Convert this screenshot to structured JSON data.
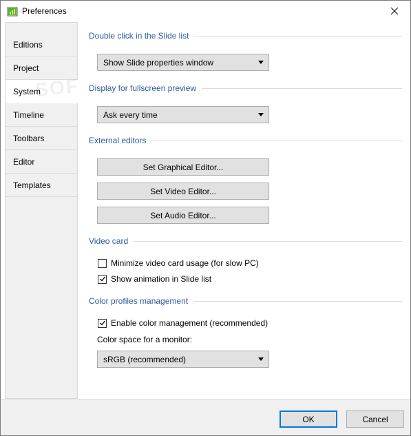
{
  "window": {
    "title": "Preferences"
  },
  "icons": {
    "app": "app-icon",
    "close": "close-icon",
    "checkmark": "checkmark-icon",
    "dropdown_arrow": "chevron-down-icon"
  },
  "sidebar": {
    "items": [
      {
        "label": "Editions"
      },
      {
        "label": "Project"
      },
      {
        "label": "System"
      },
      {
        "label": "Timeline"
      },
      {
        "label": "Toolbars"
      },
      {
        "label": "Editor"
      },
      {
        "label": "Templates"
      }
    ],
    "active": "System"
  },
  "main": {
    "double_click": {
      "header": "Double click in the Slide list",
      "selected": "Show Slide properties window"
    },
    "fullscreen_preview": {
      "header": "Display for fullscreen preview",
      "selected": "Ask every time"
    },
    "external_editors": {
      "header": "External editors",
      "graphical": "Set Graphical Editor...",
      "video": "Set Video Editor...",
      "audio": "Set Audio Editor..."
    },
    "video_card": {
      "header": "Video card",
      "minimize_label": "Minimize video card usage (for slow PC)",
      "minimize_checked": false,
      "animation_label": "Show animation in Slide list",
      "animation_checked": true
    },
    "color_profiles": {
      "header": "Color profiles management",
      "enable_label": "Enable color management (recommended)",
      "enable_checked": true,
      "monitor_label": "Color space for a monitor:",
      "monitor_selected": "sRGB (recommended)"
    }
  },
  "footer": {
    "ok_label": "OK",
    "cancel_label": "Cancel"
  },
  "watermark": "SOFTPEDIA",
  "colors": {
    "group_header": "#2c5aa0",
    "sidebar_bg": "#f0f0f0",
    "button_bg": "#e1e1e1",
    "primary_border": "#0078d7"
  }
}
